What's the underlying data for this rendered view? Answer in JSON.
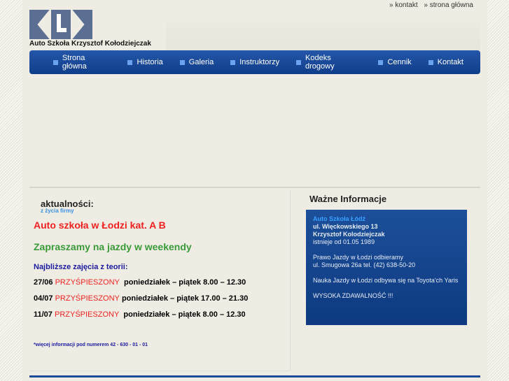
{
  "top_links": [
    "» kontakt",
    "» strona główna"
  ],
  "brand": "Auto Szkoła Krzysztof Kołodziejczak",
  "nav": [
    "Strona główna",
    "Historia",
    "Galeria",
    "Instruktorzy",
    "Kodeks drogowy",
    "Cennik",
    "Kontakt"
  ],
  "news": {
    "title": "aktualności:",
    "subtitle": "z życia firmy",
    "headline": "Auto szkoła w Łodzi kat. A B",
    "weekend": "Zapraszamy na jazdy w weekendy",
    "theory_title": "Najbliższe zajęcia z teorii:",
    "classes": [
      {
        "date": "27/06",
        "type": "PRZYŚPIESZONY",
        "time": "poniedziałek – piątek 8.00 – 12.30"
      },
      {
        "date": "04/07",
        "type": "PRZYŚPIESZONY",
        "time": "poniedziałek – piątek 17.00 – 21.30"
      },
      {
        "date": "11/07",
        "type": "PRZYŚPIESZONY",
        "time": "poniedziałek – piątek 8.00 – 12.30"
      }
    ],
    "note": "*więcej informacji pod numerem 42 - 630 - 01 - 01"
  },
  "info": {
    "title": "Ważne Informacje",
    "name": "Auto Szkoła Łódź",
    "address": "ul. Więckowskiego 13",
    "owner": "Krzysztof Kolodziejczak",
    "since": "istnieje od 01.05 1989",
    "p2a": "Prawo Jazdy w Łodzi odbieramy",
    "p2b": "ul. Smugowa 26a tel. (42) 638-50-20",
    "p3": "Nauka Jazdy w Łodzi odbywa się na Toyota'ch Yaris",
    "p4": "WYSOKA ZDAWALNOŚĆ !!!"
  }
}
